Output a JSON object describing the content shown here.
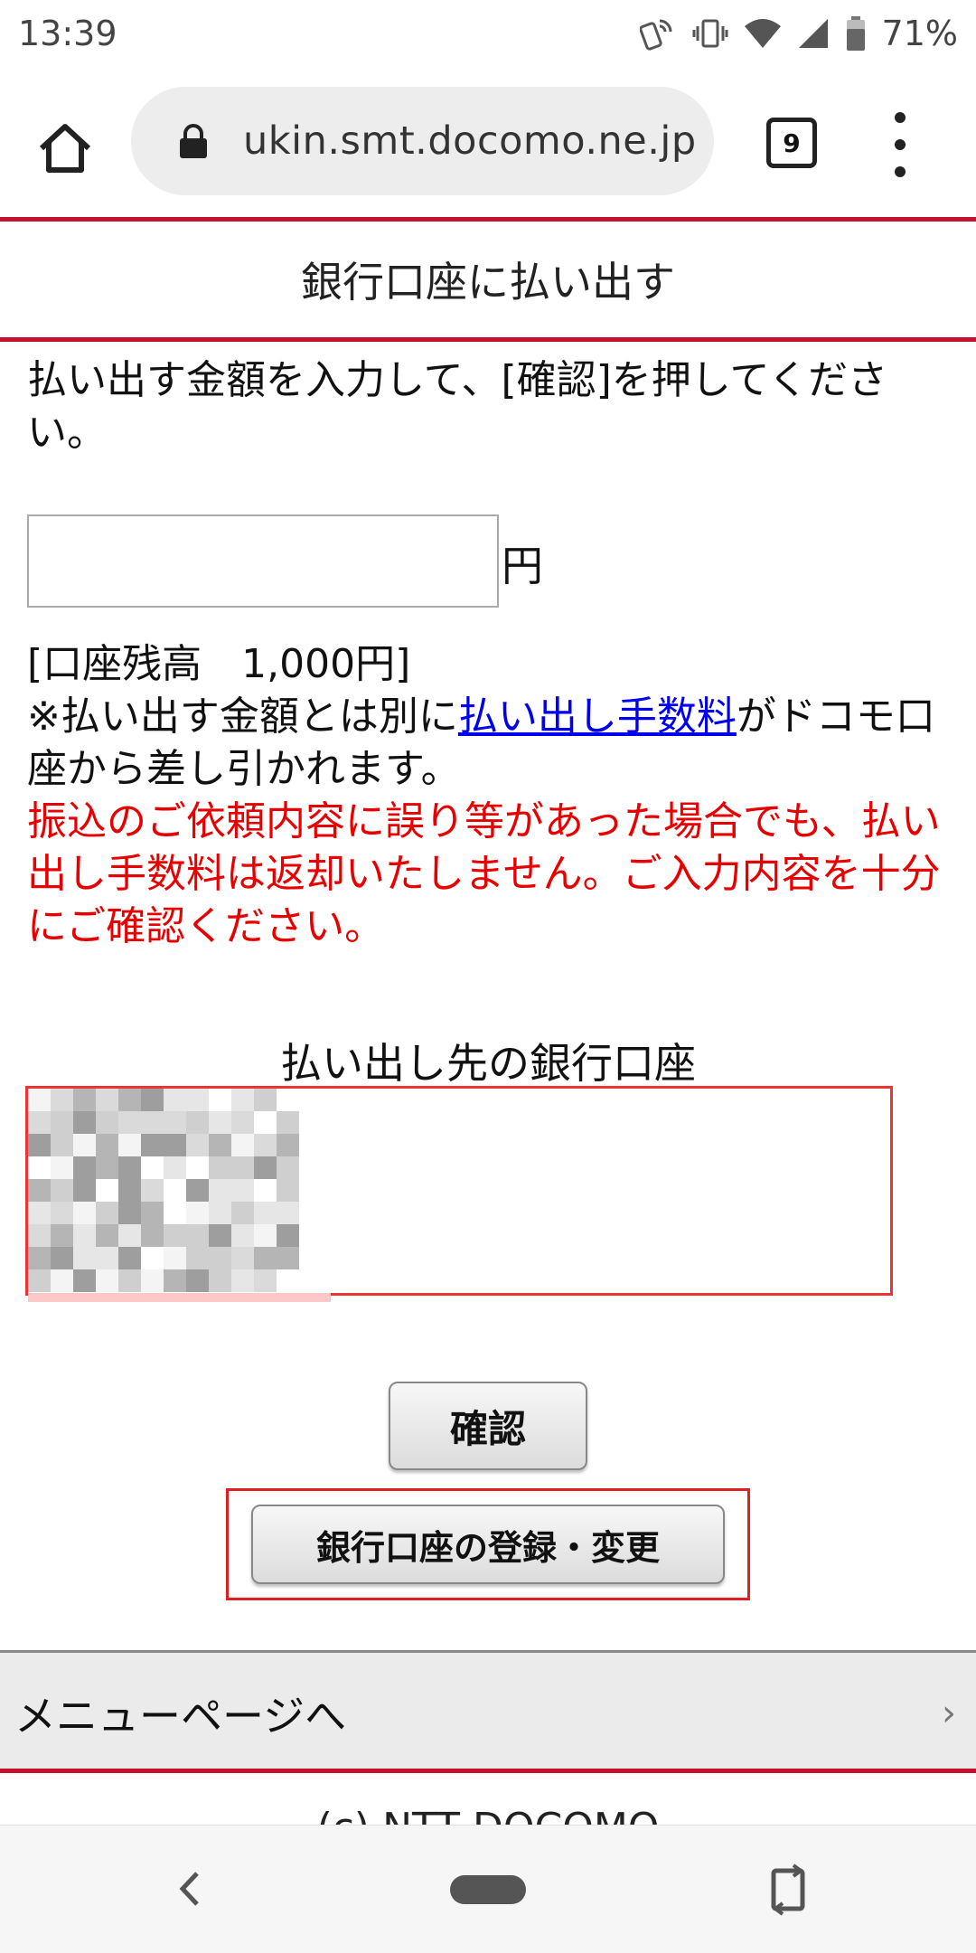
{
  "status_bar": {
    "time": "13:39",
    "battery": "71%"
  },
  "browser": {
    "url": "ukin.smt.docomo.ne.jp",
    "tab_count": "9"
  },
  "page": {
    "title": "銀行口座に払い出す",
    "instruction": "払い出す金額を入力して、[確認]を押してください。",
    "amount": {
      "value": "",
      "unit": "円"
    },
    "balance": "[口座残高　1,000円]",
    "fee_note_prefix": "※払い出す金額とは別に",
    "fee_link": "払い出し手数料",
    "fee_note_suffix": "がドコモ口座から差し引かれます。",
    "warning": "振込のご依頼内容に誤り等があった場合でも、払い出し手数料は返却いたしません。ご入力内容を十分にご確認ください。",
    "destination_title": "払い出し先の銀行口座",
    "confirm_button": "確認",
    "register_button": "銀行口座の登録・変更",
    "menu_link": "メニューページへ",
    "menu_chevron": "›",
    "copyright": "(c) NTT DOCOMO"
  },
  "colors": {
    "accent": "#c4112d",
    "warning": "#e80000",
    "link": "#0000ee"
  }
}
